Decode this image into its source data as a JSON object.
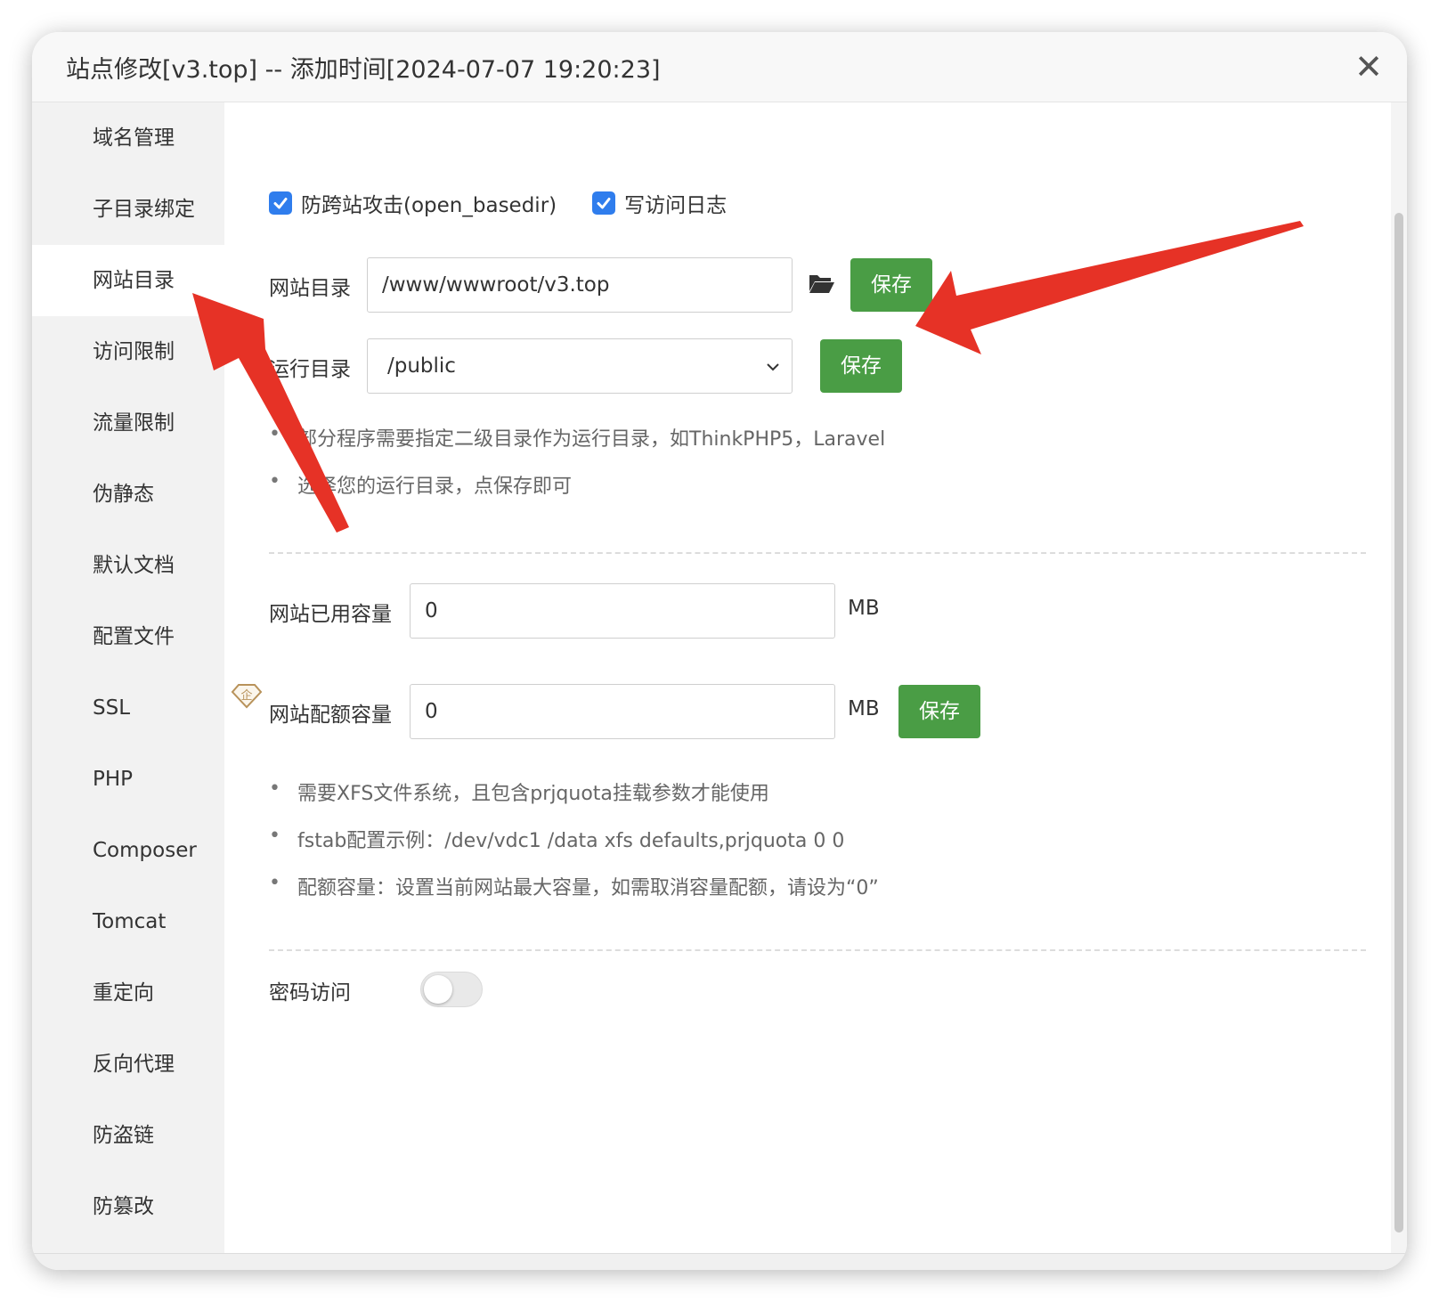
{
  "dialog": {
    "title": "站点修改[v3.top] -- 添加时间[2024-07-07 19:20:23]",
    "close_icon": "close-icon"
  },
  "sidebar": {
    "items": [
      {
        "label": "域名管理",
        "active": false
      },
      {
        "label": "子目录绑定",
        "active": false
      },
      {
        "label": "网站目录",
        "active": true
      },
      {
        "label": "访问限制",
        "active": false
      },
      {
        "label": "流量限制",
        "active": false
      },
      {
        "label": "伪静态",
        "active": false
      },
      {
        "label": "默认文档",
        "active": false
      },
      {
        "label": "配置文件",
        "active": false
      },
      {
        "label": "SSL",
        "active": false
      },
      {
        "label": "PHP",
        "active": false
      },
      {
        "label": "Composer",
        "active": false
      },
      {
        "label": "Tomcat",
        "active": false
      },
      {
        "label": "重定向",
        "active": false
      },
      {
        "label": "反向代理",
        "active": false
      },
      {
        "label": "防盗链",
        "active": false
      },
      {
        "label": "防篡改",
        "active": false
      }
    ]
  },
  "options": {
    "open_basedir_label": "防跨站攻击(open_basedir)",
    "open_basedir_checked": true,
    "access_log_label": "写访问日志",
    "access_log_checked": true
  },
  "site_dir": {
    "label": "网站目录",
    "value": "/www/wwwroot/v3.top",
    "folder_icon": "folder-open-icon",
    "save_label": "保存"
  },
  "run_dir": {
    "label": "运行目录",
    "selected": "/public",
    "save_label": "保存"
  },
  "run_dir_tips": [
    "部分程序需要指定二级目录作为运行目录，如ThinkPHP5，Laravel",
    "选择您的运行目录，点保存即可"
  ],
  "used_capacity": {
    "label": "网站已用容量",
    "value": "0",
    "unit": "MB"
  },
  "quota_capacity": {
    "label": "网站配额容量",
    "value": "0",
    "unit": "MB",
    "save_label": "保存",
    "badge_icon": "enterprise-diamond-icon",
    "badge_char": "企"
  },
  "quota_tips": [
    "需要XFS文件系统，且包含prjquota挂载参数才能使用",
    "fstab配置示例：/dev/vdc1 /data xfs defaults,prjquota 0 0",
    "配额容量：设置当前网站最大容量，如需取消容量配额，请设为“0”"
  ],
  "password_access": {
    "label": "密码访问",
    "enabled": false
  },
  "colors": {
    "accent_green": "#4a9d45",
    "checkbox_blue": "#2f7ded",
    "annotation_red": "#e63226",
    "badge_gold": "#b8925a"
  }
}
